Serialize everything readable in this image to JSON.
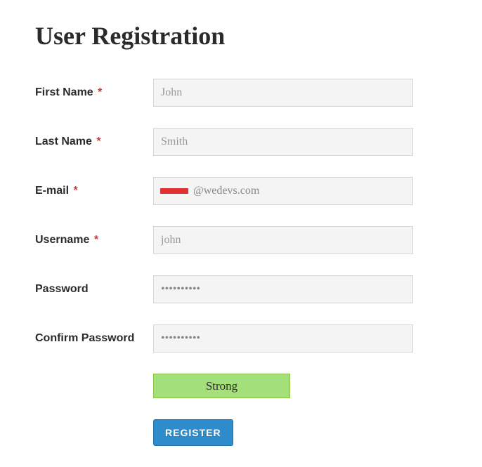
{
  "title": "User Registration",
  "fields": {
    "firstName": {
      "label": "First Name",
      "required": true,
      "placeholder": "John"
    },
    "lastName": {
      "label": "Last Name",
      "required": true,
      "placeholder": "Smith"
    },
    "email": {
      "label": "E-mail",
      "required": true,
      "value": "@wedevs.com"
    },
    "username": {
      "label": "Username",
      "required": true,
      "placeholder": "john"
    },
    "password": {
      "label": "Password",
      "required": false,
      "value": "••••••••••"
    },
    "confirmPassword": {
      "label": "Confirm Password",
      "required": false,
      "value": "••••••••••"
    }
  },
  "strength": {
    "label": "Strong"
  },
  "submit": {
    "label": "REGISTER"
  },
  "requiredMark": "*"
}
